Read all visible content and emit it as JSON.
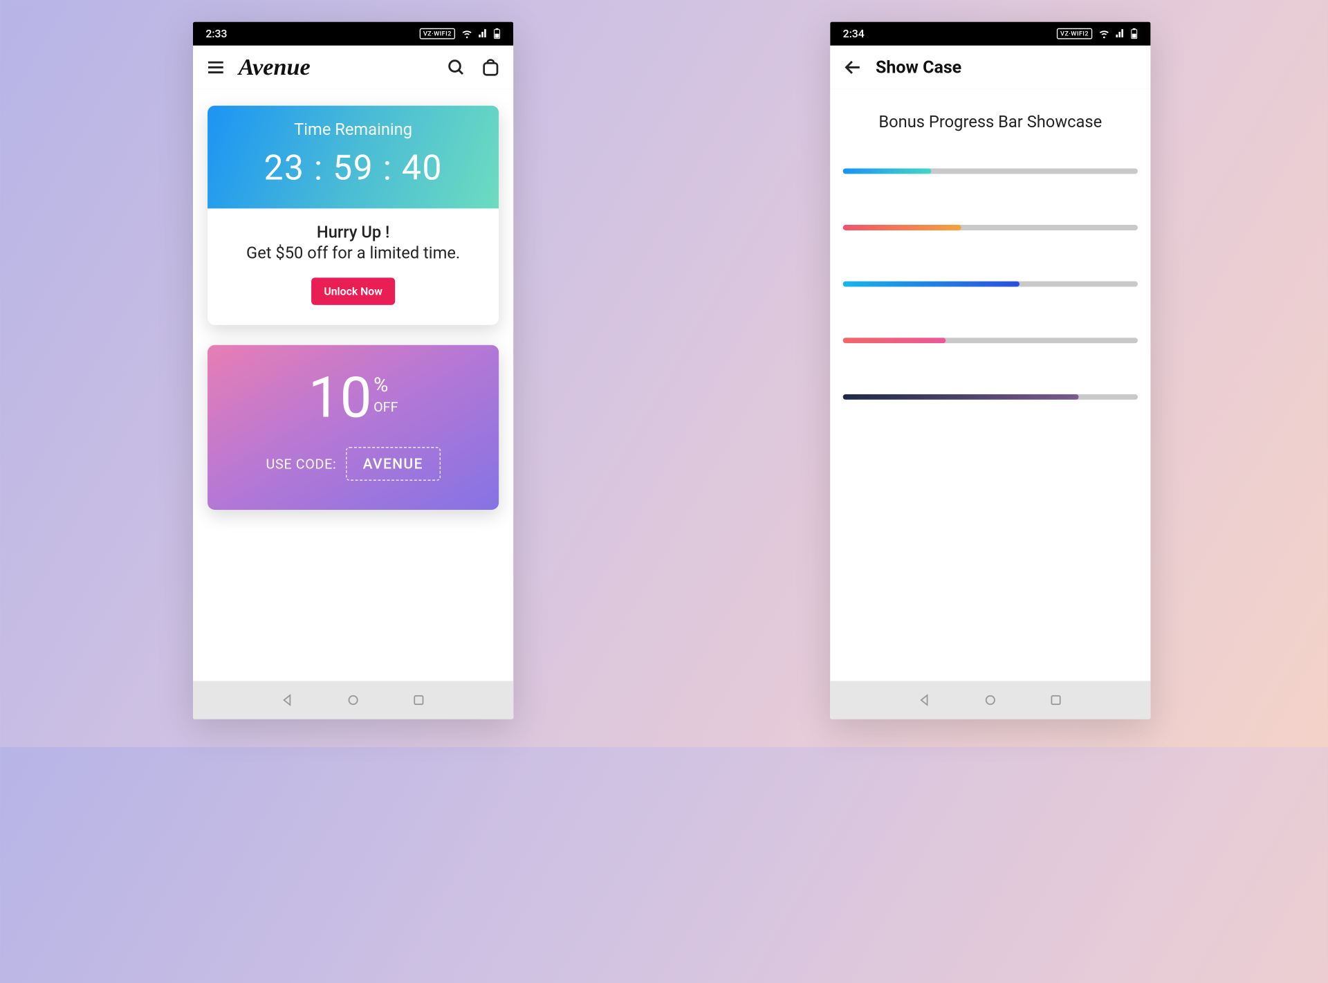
{
  "phone1": {
    "status": {
      "time": "2:33",
      "wifi_label": "VZ·WIFI2"
    },
    "app_title": "Avenue",
    "timer": {
      "label": "Time Remaining",
      "value": "23 : 59 : 40",
      "hurry": "Hurry Up !",
      "offer": "Get $50 off for a limited time.",
      "cta": "Unlock Now"
    },
    "promo": {
      "number": "10",
      "percent": "%",
      "off": "OFF",
      "use_code_label": "USE CODE:",
      "code": "AVENUE"
    }
  },
  "phone2": {
    "status": {
      "time": "2:34",
      "wifi_label": "VZ·WIFI2"
    },
    "app_title": "Show Case",
    "showcase_title": "Bonus Progress Bar Showcase",
    "bars": [
      {
        "percent": 30,
        "gradient": "linear-gradient(90deg,#1893f5,#46d6c4)"
      },
      {
        "percent": 40,
        "gradient": "linear-gradient(90deg,#f0536c,#f7a23e)"
      },
      {
        "percent": 60,
        "gradient": "linear-gradient(90deg,#17b6ea,#2a4ee0)"
      },
      {
        "percent": 35,
        "gradient": "linear-gradient(90deg,#f06767,#ee5699)"
      },
      {
        "percent": 80,
        "gradient": "linear-gradient(90deg,#1e2a44,#7a5a8e)"
      }
    ]
  }
}
